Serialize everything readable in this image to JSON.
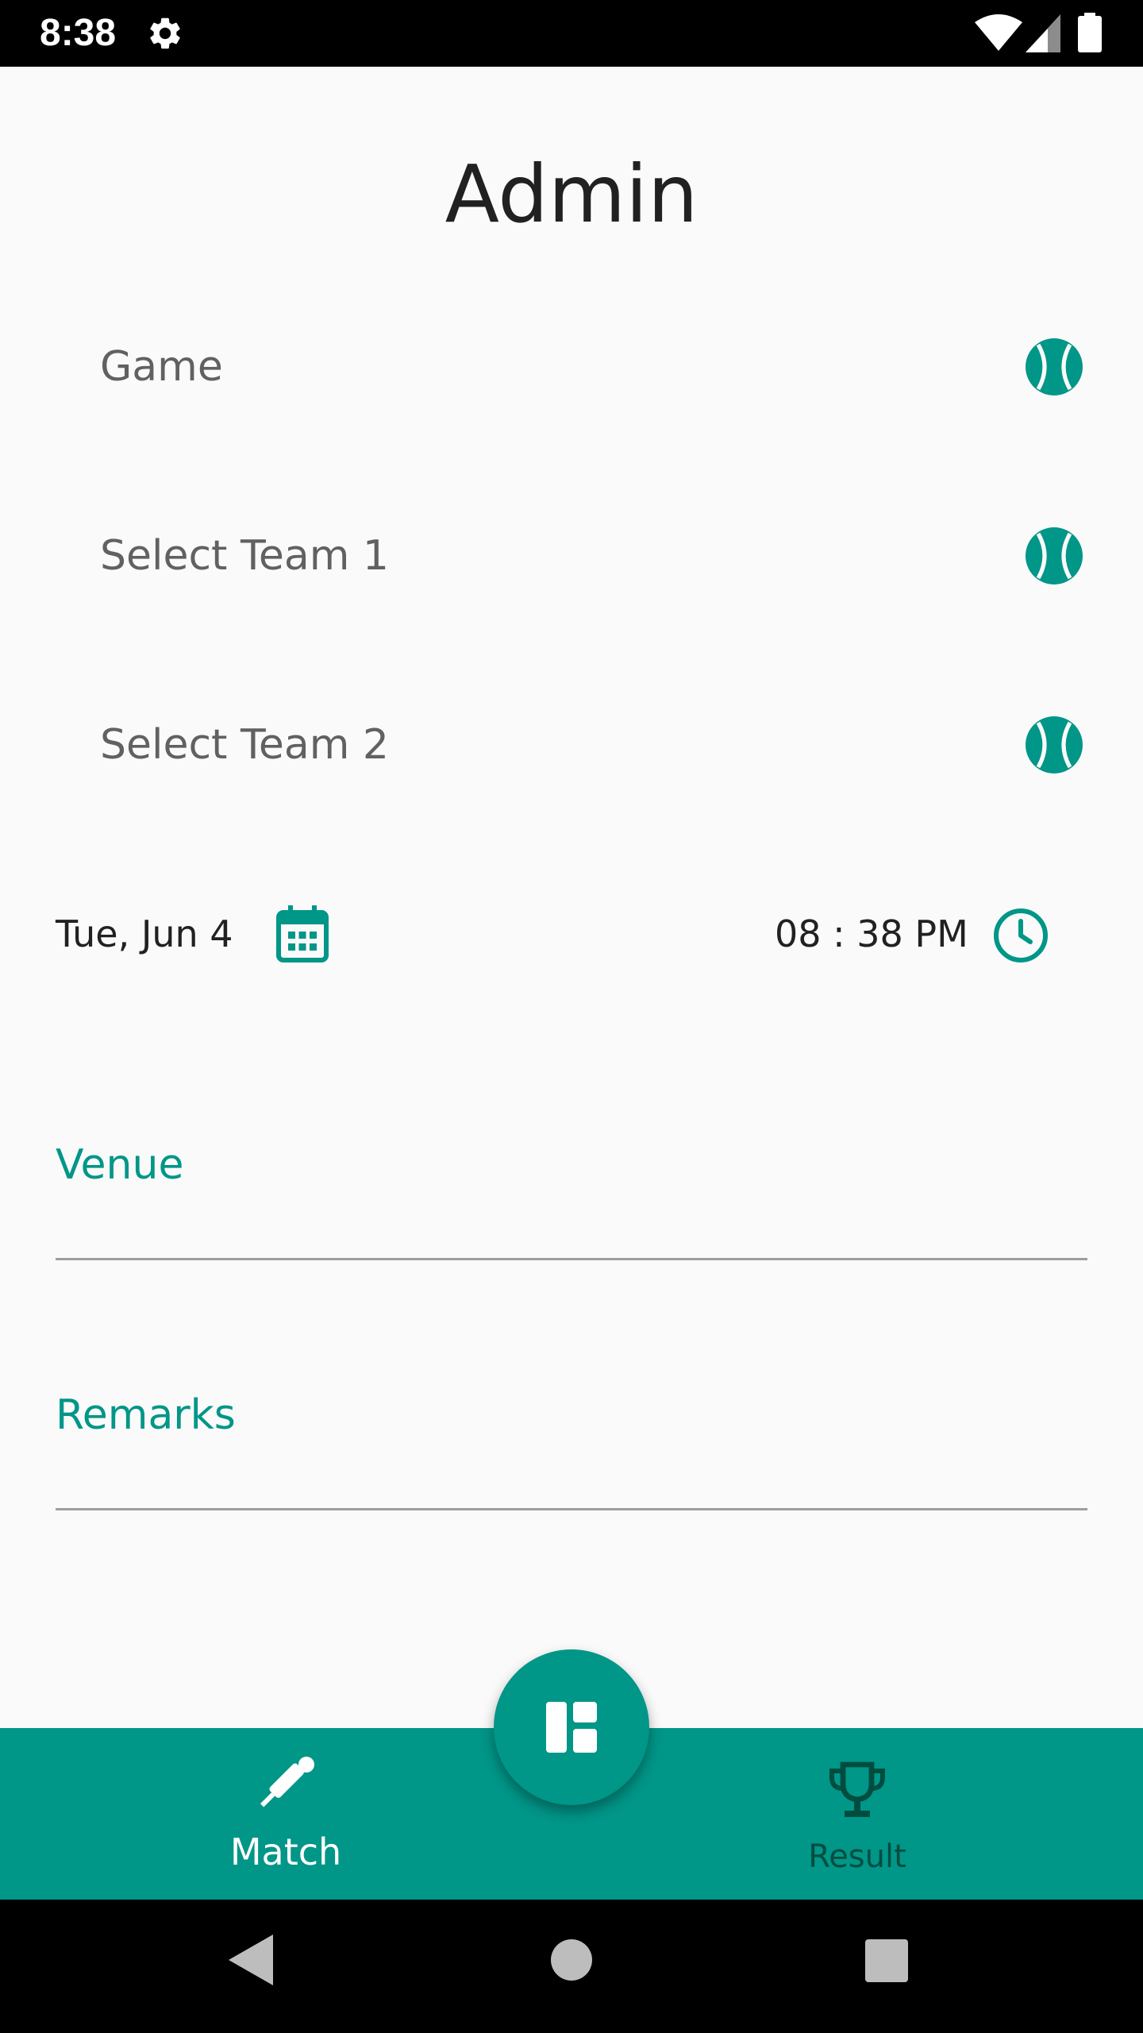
{
  "status_bar": {
    "time": "8:38"
  },
  "page": {
    "title": "Admin"
  },
  "selectors": [
    {
      "label": "Game",
      "icon": "ball-icon"
    },
    {
      "label": "Select Team 1",
      "icon": "ball-icon"
    },
    {
      "label": "Select Team 2",
      "icon": "ball-icon"
    }
  ],
  "datetime": {
    "date": "Tue, Jun 4",
    "time": "08 : 38 PM"
  },
  "fields": {
    "venue_label": "Venue",
    "venue_value": "",
    "remarks_label": "Remarks",
    "remarks_value": ""
  },
  "bottom_nav": {
    "items": [
      {
        "label": "Match",
        "icon": "cricket-bat-icon",
        "active": true
      },
      {
        "label": "Result",
        "icon": "trophy-icon",
        "active": false
      }
    ],
    "fab_icon": "dashboard-icon"
  },
  "colors": {
    "accent": "#009688",
    "background": "#fafafa",
    "text_primary": "#212121",
    "text_secondary": "#616161"
  }
}
